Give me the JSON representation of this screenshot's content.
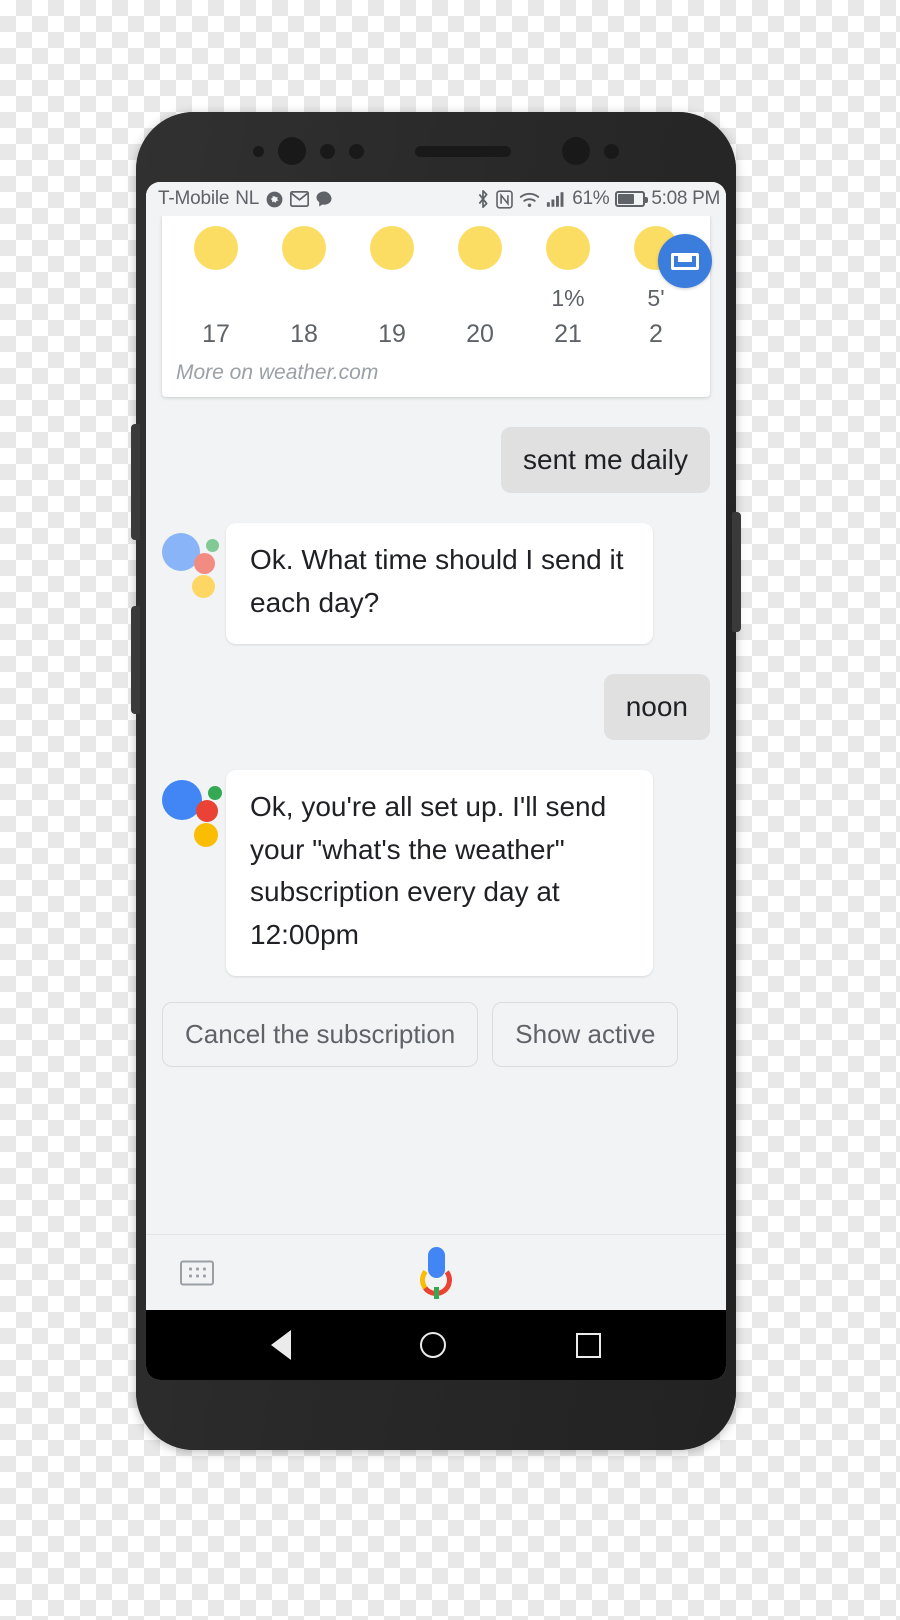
{
  "device": {
    "frame_color": "#2b2b2b"
  },
  "status_bar": {
    "carrier": "T-Mobile",
    "network": "NL",
    "left_icons": [
      "settings-icon",
      "gmail-icon",
      "chat-bubble-icon"
    ],
    "right_icons": [
      "bluetooth-icon",
      "nfc-icon",
      "wifi-icon",
      "cellular-signal-icon"
    ],
    "battery_percent": "61%",
    "time": "5:08 PM"
  },
  "weather_card": {
    "link_text": "More on weather.com",
    "badge_icon": "keyboard-spacebar-badge-icon",
    "hours": [
      {
        "hour": "17",
        "pop": "",
        "icon": "sun-icon"
      },
      {
        "hour": "18",
        "pop": "",
        "icon": "sun-icon"
      },
      {
        "hour": "19",
        "pop": "",
        "icon": "sun-icon"
      },
      {
        "hour": "20",
        "pop": "",
        "icon": "sun-icon"
      },
      {
        "hour": "21",
        "pop": "1%",
        "icon": "sun-icon"
      },
      {
        "hour": "2",
        "pop": "5'",
        "icon": "sun-icon"
      }
    ]
  },
  "conversation": [
    {
      "role": "user",
      "text": "sent me daily"
    },
    {
      "role": "assistant",
      "avatar": "google-assistant-logo",
      "text": "Ok. What time should I send it each day?"
    },
    {
      "role": "user",
      "text": "noon"
    },
    {
      "role": "assistant",
      "avatar": "google-assistant-logo",
      "text": "Ok, you're all set up. I'll send your \"what's the weather\" subscription every day at 12:00pm"
    }
  ],
  "suggestion_chips": [
    {
      "label": "Cancel the subscription"
    },
    {
      "label": "Show active"
    }
  ],
  "input_bar": {
    "keyboard_icon": "keyboard-icon",
    "mic_icon": "google-mic-icon"
  },
  "nav_bar": {
    "back": "back-nav-icon",
    "home": "home-nav-icon",
    "recents": "recents-nav-icon"
  },
  "colors": {
    "assistant_blue": "#4285f4",
    "assistant_red": "#ea4335",
    "assistant_yellow": "#fbbc04",
    "assistant_green": "#34a853",
    "sun_yellow": "#fbdd64",
    "user_bubble": "#e0e0e0",
    "screen_bg": "#f1f3f4"
  }
}
